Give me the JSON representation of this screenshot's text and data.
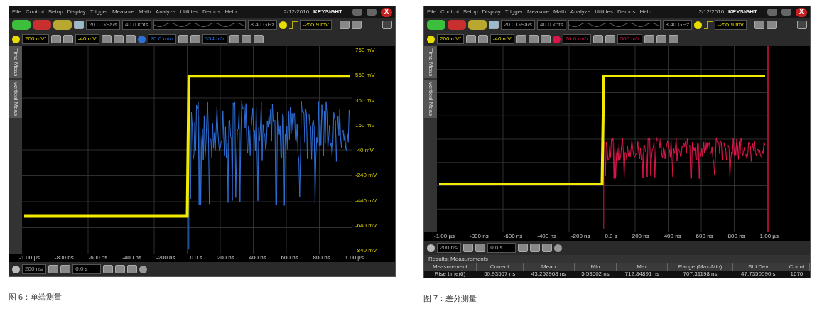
{
  "figures": [
    {
      "scope": {
        "menu": [
          "File",
          "Control",
          "Setup",
          "Display",
          "Trigger",
          "Measure",
          "Math",
          "Analyze",
          "Utilities",
          "Demos",
          "Help"
        ],
        "date": "2/12/2016",
        "brand": "KEYSIGHT",
        "close_label": "X",
        "sample_rate": "20.0 GSa/s",
        "memory_depth": "40.0 kpts",
        "bandwidth": "8.40 GHz",
        "trigger_level": "-255.9 mV",
        "channels": [
          {
            "color": "#e8dc00",
            "scale": "200 mV/",
            "offset": "-40 mV"
          },
          {
            "color": "#2f6fd8",
            "scale": "20.0 mV/",
            "offset": "354 mV"
          }
        ],
        "side_tabs": [
          "Time Meas",
          "Vertical Meas"
        ],
        "y_axis_labels": [
          "760 mV",
          "560 mV",
          "360 mV",
          "160 mV",
          "-40 mV",
          "-240 mV",
          "-440 mV",
          "-640 mV",
          "-840 mV"
        ],
        "x_axis_labels": [
          "-1.00 µs",
          "-800 ns",
          "-600 ns",
          "-400 ns",
          "-200 ns",
          "0.0 s",
          "200 ns",
          "400 ns",
          "600 ns",
          "800 ns",
          "1.00 µs"
        ],
        "traces": [
          {
            "kind": "noise",
            "color": "#2f6fd8"
          },
          {
            "kind": "step",
            "color": "#f2ea00"
          }
        ],
        "timebase": "200 ns/",
        "position": "0.0 s"
      },
      "caption": "图 6：单端测量"
    },
    {
      "scope": {
        "menu": [
          "File",
          "Control",
          "Setup",
          "Display",
          "Trigger",
          "Measure",
          "Math",
          "Analyze",
          "Utilities",
          "Demos",
          "Help"
        ],
        "date": "2/12/2016",
        "brand": "KEYSIGHT",
        "close_label": "X",
        "sample_rate": "20.0 GSa/s",
        "memory_depth": "40.0 kpts",
        "bandwidth": "8.40 GHz",
        "trigger_level": "-255.9 mV",
        "channels": [
          {
            "color": "#e8dc00",
            "scale": "200 mV/",
            "offset": "-40 mV"
          },
          {
            "color": "#d8164a",
            "scale": "20.0 mV/",
            "offset": "500 mV"
          }
        ],
        "side_tabs": [
          "Time Meas",
          "Vertical Meas"
        ],
        "x_axis_labels": [
          "-1.00 µs",
          "-800 ns",
          "-600 ns",
          "-400 ns",
          "-200 ns",
          "0.0 s",
          "200 ns",
          "400 ns",
          "600 ns",
          "800 ns",
          "1.00 µs"
        ],
        "traces": [
          {
            "kind": "noise",
            "color": "#e0174c"
          },
          {
            "kind": "step",
            "color": "#f2ea00"
          }
        ],
        "timebase": "200 ns/",
        "position": "0.0 s",
        "results": {
          "title": "Results: Measurements",
          "columns": [
            "Measurement",
            "Current",
            "Mean",
            "Min",
            "Max",
            "Range (Max-Min)",
            "Std Dev",
            "Count"
          ],
          "rows": [
            [
              "Rise time(6)",
              "50.93557 ns",
              "43.252968 ns",
              "5.53602 ns",
              "712.84891 ns",
              "707.31198 ns",
              "47.7350090 s",
              "1676"
            ]
          ]
        }
      },
      "caption": "图 7：差分测量"
    }
  ]
}
